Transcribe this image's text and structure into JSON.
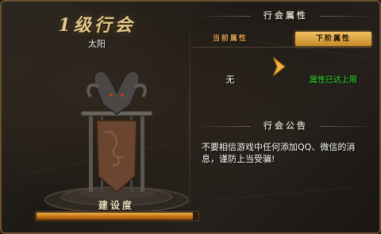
{
  "guild": {
    "level_title": "1级行会",
    "name": "太阳",
    "construct_label": "建设度",
    "construct_progress": 0.97
  },
  "attributes": {
    "header": "行会属性",
    "current_label": "当前属性",
    "next_label": "下阶属性",
    "current_value": "无",
    "next_value": "属性已达上限"
  },
  "notice": {
    "header": "行会公告",
    "text": "不要相信游戏中任何添加QQ、微信的消息，谨防上当受骗!"
  },
  "colors": {
    "accent_gold": "#e6c88a",
    "progress_orange": "#f0b050",
    "max_green": "#33e033"
  }
}
